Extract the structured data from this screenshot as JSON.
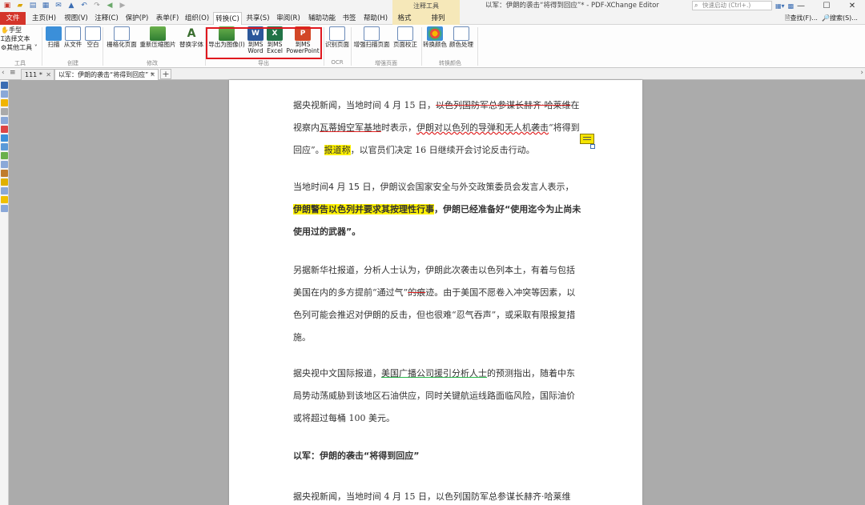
{
  "titlebar": {
    "context_tools_label": "注释工具",
    "window_title": "以军：伊朗的袭击“将得到回应”* - PDF-XChange Editor",
    "quick_launch_placeholder": "快速启动 (Ctrl+.)"
  },
  "menu": {
    "items": [
      {
        "label": "文件"
      },
      {
        "label": "主页(H)"
      },
      {
        "label": "视图(V)"
      },
      {
        "label": "注释(C)"
      },
      {
        "label": "保护(P)"
      },
      {
        "label": "表单(F)"
      },
      {
        "label": "组织(O)"
      },
      {
        "label": "转换(C)"
      },
      {
        "label": "共享(S)"
      },
      {
        "label": "审阅(R)"
      },
      {
        "label": "辅助功能"
      },
      {
        "label": "书签"
      },
      {
        "label": "帮助(H)"
      },
      {
        "label": "格式"
      },
      {
        "label": "排列"
      }
    ],
    "find_label": "查找(F)...",
    "search_label": "搜索(S)..."
  },
  "ribbon": {
    "tools": {
      "hand": "手型",
      "select_text": "选择文本",
      "other_tools": "其他工具",
      "group": "工具"
    },
    "create": {
      "scan": "扫描",
      "from_file": "从文件",
      "blank": "空白",
      "group": "创建"
    },
    "modify": {
      "rasterize": "栅格化页面",
      "recompress": "重新压缩图片",
      "replace_fonts": "替换字体",
      "group": "修改"
    },
    "export": {
      "to_image": "导出为图像(I)",
      "to_word_1": "到MS",
      "to_word_2": "Word",
      "to_excel_1": "到MS",
      "to_excel_2": "Excel",
      "to_ppt_1": "到MS",
      "to_ppt_2": "PowerPoint",
      "group": "导出"
    },
    "ocr": {
      "recognize": "识别页面",
      "group": "OCR"
    },
    "scanned": {
      "enhance": "增强扫描页面",
      "deskew": "页面校正",
      "group": "增强页面"
    },
    "colors": {
      "convert": "转换颜色",
      "process": "颜色处理",
      "group": "转换颜色"
    }
  },
  "tabs": [
    {
      "label": "111 *"
    },
    {
      "label": "以军：伊朗的袭击“将得到回应” *"
    }
  ],
  "document": {
    "p1_a": "据央视新闻，当地时间 4 月 15 日，",
    "p1_strike": "以色列国防军总参谋长赫齐·哈莱维",
    "p1_b": "在视察内",
    "p1_ul1": "瓦蒂姆空军基地",
    "p1_c": "时表示，",
    "p1_ul2": "伊朗对以色列的导弹和无人机袭击",
    "p1_d": "“将得到回应”。",
    "p1_hl": "报道称",
    "p1_e": "，以官员们决定 16 日继续开会讨论反击行动。",
    "p2_a": "当地时间4 月 15 日，伊朗议会国家安全与外交政策委员会发言人表示，",
    "p2_hl": "伊朗警告以色列并要求其按理性行事",
    "p2_b": "，伊朗已经准备好“使用迄今为止尚未使用过的武器”。",
    "p3_a": "另据新华社报道，分析人士认为，伊朗此次袭击以色列本土，有着与包括美国在内的多方提前“通过气”",
    "p3_strike": "的痕",
    "p3_b": "迹。由于美国不愿卷入冲突等因素，以色列可能会推迟对伊朗的反击，但也很难“忍气吞声”，或采取有限报复措施。",
    "p4_a": "据央视中文国际报道，",
    "p4_ul": "美国广播公司援引分析人士",
    "p4_b": "的预测指出，随着中东局势动荡威胁到该地区石油供应，同时关键航运线路面临风险，国际油价或将超过每桶 100 美元。",
    "p5": "以军：伊朗的袭击“将得到回应”",
    "p6": "据央视新闻，当地时间 4 月 15 日，以色列国防军总参谋长赫齐·哈莱维"
  }
}
